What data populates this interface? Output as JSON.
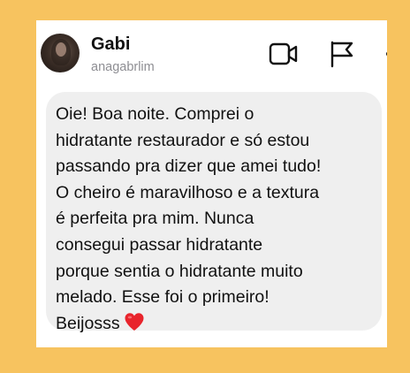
{
  "header": {
    "name": "Gabi",
    "username": "anagabrlim"
  },
  "icons": {
    "avatar": "profile-photo",
    "video": "video-camera-icon",
    "flag": "flag-icon",
    "more": "more-icon"
  },
  "message": {
    "lines": [
      "Oie! Boa noite. Comprei o",
      "hidratante restaurador e só estou",
      "passando pra dizer que amei tudo!",
      "O cheiro é maravilhoso e a textura",
      "é perfeita pra mim. Nunca",
      "consegui passar hidratante",
      "porque sentia o hidratante muito",
      "melado. Esse foi o primeiro!",
      "Beijosss"
    ],
    "emoji": "heart-emoji"
  },
  "colors": {
    "background": "#f7c35f",
    "bubble": "#efefef",
    "heart": "#e8242c"
  }
}
